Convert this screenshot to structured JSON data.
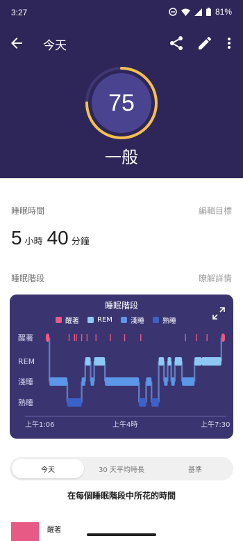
{
  "status_bar": {
    "time": "3:27",
    "battery": "81%"
  },
  "app_bar": {
    "title": "今天"
  },
  "score": {
    "value": 75,
    "max": 100,
    "label": "一般",
    "ring_color": "#f2c14e"
  },
  "sleep_time": {
    "label": "睡眠時間",
    "edit_goal": "編輯目標",
    "hours": "5",
    "hours_unit": "小時",
    "minutes": "40",
    "minutes_unit": "分鐘"
  },
  "sleep_stages": {
    "label": "睡眠階段",
    "learn_more": "瞭解詳情"
  },
  "chart_data": {
    "type": "step",
    "title": "睡眠階段",
    "legend": [
      {
        "name": "醒著",
        "color": "#e85a86"
      },
      {
        "name": "REM",
        "color": "#8ec8f5"
      },
      {
        "name": "淺睡",
        "color": "#5b97e8"
      },
      {
        "name": "熟睡",
        "color": "#3a62c9"
      }
    ],
    "y_levels": [
      "醒著",
      "REM",
      "淺睡",
      "熟睡"
    ],
    "x_ticks": [
      "上午1:06",
      "上午4時",
      "上午7:30"
    ],
    "start_time": "1:06",
    "end_time": "7:30",
    "stages": [
      {
        "stage": "醒著",
        "start": 0.0,
        "end": 0.02
      },
      {
        "stage": "淺睡",
        "start": 0.02,
        "end": 0.12
      },
      {
        "stage": "熟睡",
        "start": 0.12,
        "end": 0.2
      },
      {
        "stage": "淺睡",
        "start": 0.2,
        "end": 0.22
      },
      {
        "stage": "REM",
        "start": 0.22,
        "end": 0.25
      },
      {
        "stage": "淺睡",
        "start": 0.25,
        "end": 0.27
      },
      {
        "stage": "REM",
        "start": 0.27,
        "end": 0.33
      },
      {
        "stage": "淺睡",
        "start": 0.33,
        "end": 0.52
      },
      {
        "stage": "熟睡",
        "start": 0.52,
        "end": 0.56
      },
      {
        "stage": "淺睡",
        "start": 0.56,
        "end": 0.59
      },
      {
        "stage": "熟睡",
        "start": 0.59,
        "end": 0.63
      },
      {
        "stage": "REM",
        "start": 0.63,
        "end": 0.66
      },
      {
        "stage": "淺睡",
        "start": 0.66,
        "end": 0.68
      },
      {
        "stage": "REM",
        "start": 0.68,
        "end": 0.7
      },
      {
        "stage": "淺睡",
        "start": 0.7,
        "end": 0.72
      },
      {
        "stage": "REM",
        "start": 0.72,
        "end": 0.76
      },
      {
        "stage": "淺睡",
        "start": 0.76,
        "end": 0.83
      },
      {
        "stage": "REM",
        "start": 0.83,
        "end": 0.87
      },
      {
        "stage": "REM",
        "start": 0.87,
        "end": 0.98
      },
      {
        "stage": "醒著",
        "start": 0.98,
        "end": 1.0
      }
    ],
    "awake_ticks": [
      0.13,
      0.16,
      0.17,
      0.2,
      0.23,
      0.28,
      0.36,
      0.44,
      0.53,
      0.78,
      0.84,
      0.9
    ]
  },
  "tabs": {
    "items": [
      "今天",
      "30 天平均時長",
      "基準"
    ],
    "selected": 0
  },
  "caption": "在每個睡眠階段中所花的時間",
  "bottom_item": {
    "label": "醒著"
  }
}
